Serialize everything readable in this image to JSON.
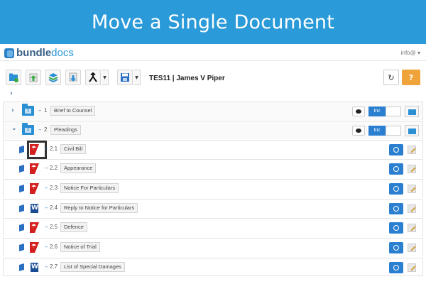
{
  "banner": {
    "title": "Move a Single Document"
  },
  "app": {
    "logo_main": "bundle",
    "logo_accent": "docs",
    "user": "info@ ▾"
  },
  "toolbar": {
    "doc_title": "TES11 | James V Piper",
    "buttons": [
      "new-folder-icon",
      "upload-green-icon",
      "add-stack-icon",
      "download-icon",
      "merge-icon",
      "save-icon"
    ],
    "refresh_glyph": "↻",
    "help_glyph": "?"
  },
  "tree": {
    "root_chevron": "›",
    "sections": [
      {
        "chevron": "›",
        "folder_num": "1",
        "dash": "–",
        "num": "1",
        "label": "Brief to Counsel",
        "inc": "Inc"
      },
      {
        "chevron": "⌄",
        "folder_num": "2",
        "dash": "–",
        "num": "2",
        "label": "Pleadings",
        "inc": "Inc"
      }
    ],
    "documents": [
      {
        "type": "pdf",
        "dash": "–",
        "num": "2.1",
        "label": "Civil Bill",
        "highlighted": true
      },
      {
        "type": "pdf",
        "dash": "–",
        "num": "2.2",
        "label": "Appearance"
      },
      {
        "type": "pdf",
        "dash": "–",
        "num": "2.3",
        "label": "Notice For Particulars"
      },
      {
        "type": "word",
        "dash": "–",
        "num": "2.4",
        "label": "Reply to Notice for Particulars"
      },
      {
        "type": "pdf",
        "dash": "–",
        "num": "2.5",
        "label": "Defence"
      },
      {
        "type": "pdf",
        "dash": "–",
        "num": "2.6",
        "label": "Notice of Trial"
      },
      {
        "type": "word",
        "dash": "–",
        "num": "2.7",
        "label": "List of Special Damages"
      }
    ]
  },
  "colors": {
    "banner": "#2b9ad8",
    "primary": "#2b7fd0",
    "help": "#f0a33a",
    "pdf": "#d41f1f",
    "word": "#1a4c94"
  }
}
